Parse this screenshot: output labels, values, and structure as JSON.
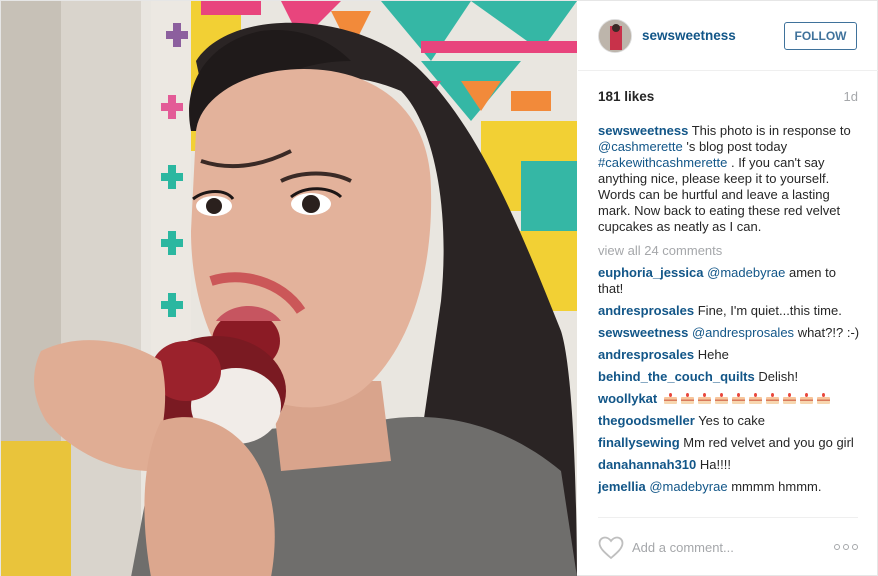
{
  "post": {
    "username": "sewsweetness",
    "follow_label": "FOLLOW",
    "likes": "181 likes",
    "age": "1d",
    "caption": {
      "username": "sewsweetness",
      "text_1": "This photo is in response to",
      "mention": "@cashmerette",
      "text_2": "'s blog post today",
      "hashtag": "#cakewithcashmerette",
      "text_3": ". If you can't say anything nice, please keep it to yourself. Words can be hurtful and leave a lasting mark. Now back to eating these red velvet cupcakes as neatly as I can."
    },
    "view_all": "view all 24 comments",
    "comments": [
      {
        "username": "euphoria_jessica",
        "mention": "@madebyrae",
        "text": "amen to that!"
      },
      {
        "username": "andresprosales",
        "mention": "",
        "text": "Fine, I'm quiet...this time."
      },
      {
        "username": "sewsweetness",
        "mention": "@andresprosales",
        "text": "what?!? :-)"
      },
      {
        "username": "andresprosales",
        "mention": "",
        "text": "Hehe"
      },
      {
        "username": "behind_the_couch_quilts",
        "mention": "",
        "text": "Delish!"
      },
      {
        "username": "woollykat",
        "mention": "",
        "text": "",
        "emoji": "birthday-cake",
        "emoji_count": 10
      },
      {
        "username": "thegoodsmeller",
        "mention": "",
        "text": "Yes to cake"
      },
      {
        "username": "finallysewing",
        "mention": "",
        "text": "Mm red velvet and you go girl"
      },
      {
        "username": "danahannah310",
        "mention": "",
        "text": "Ha!!!!"
      },
      {
        "username": "jemellia",
        "mention": "@madebyrae",
        "text": "mmmm hmmm."
      }
    ],
    "add_comment_placeholder": "Add a comment...",
    "icons": {
      "like": "heart-icon",
      "more": "more-options-icon"
    },
    "colors": {
      "username": "#125688",
      "follow": "#3f729b",
      "muted": "#a5a7aa"
    }
  }
}
